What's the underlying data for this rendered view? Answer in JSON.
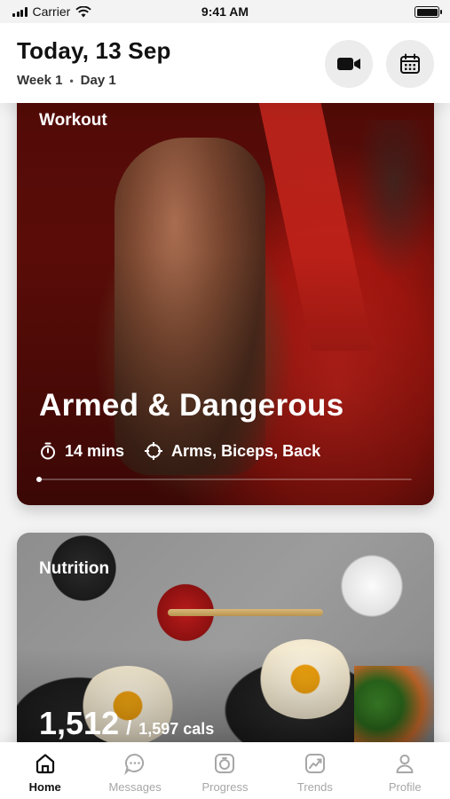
{
  "status_bar": {
    "carrier": "Carrier",
    "time": "9:41 AM"
  },
  "header": {
    "date": "Today, 13 Sep",
    "week": "Week 1",
    "separator": "•",
    "day": "Day 1",
    "video_icon": "video-camera-icon",
    "calendar_icon": "calendar-icon"
  },
  "workout": {
    "label": "Workout",
    "title": "Armed & Dangerous",
    "duration": "14 mins",
    "duration_icon": "stopwatch-icon",
    "target": "Arms, Biceps, Back",
    "target_icon": "crosshair-icon",
    "progress": 0.0
  },
  "nutrition": {
    "label": "Nutrition",
    "calories": "1,512",
    "separator": "/",
    "goal": "1,597 cals"
  },
  "tabs": [
    {
      "label": "Home",
      "icon": "home-icon",
      "active": true
    },
    {
      "label": "Messages",
      "icon": "chat-icon",
      "active": false
    },
    {
      "label": "Progress",
      "icon": "progress-icon",
      "active": false
    },
    {
      "label": "Trends",
      "icon": "trends-icon",
      "active": false
    },
    {
      "label": "Profile",
      "icon": "profile-icon",
      "active": false
    }
  ],
  "colors": {
    "accent": "#111111",
    "inactive": "#a7a7a7",
    "background": "#f3f3f3"
  }
}
